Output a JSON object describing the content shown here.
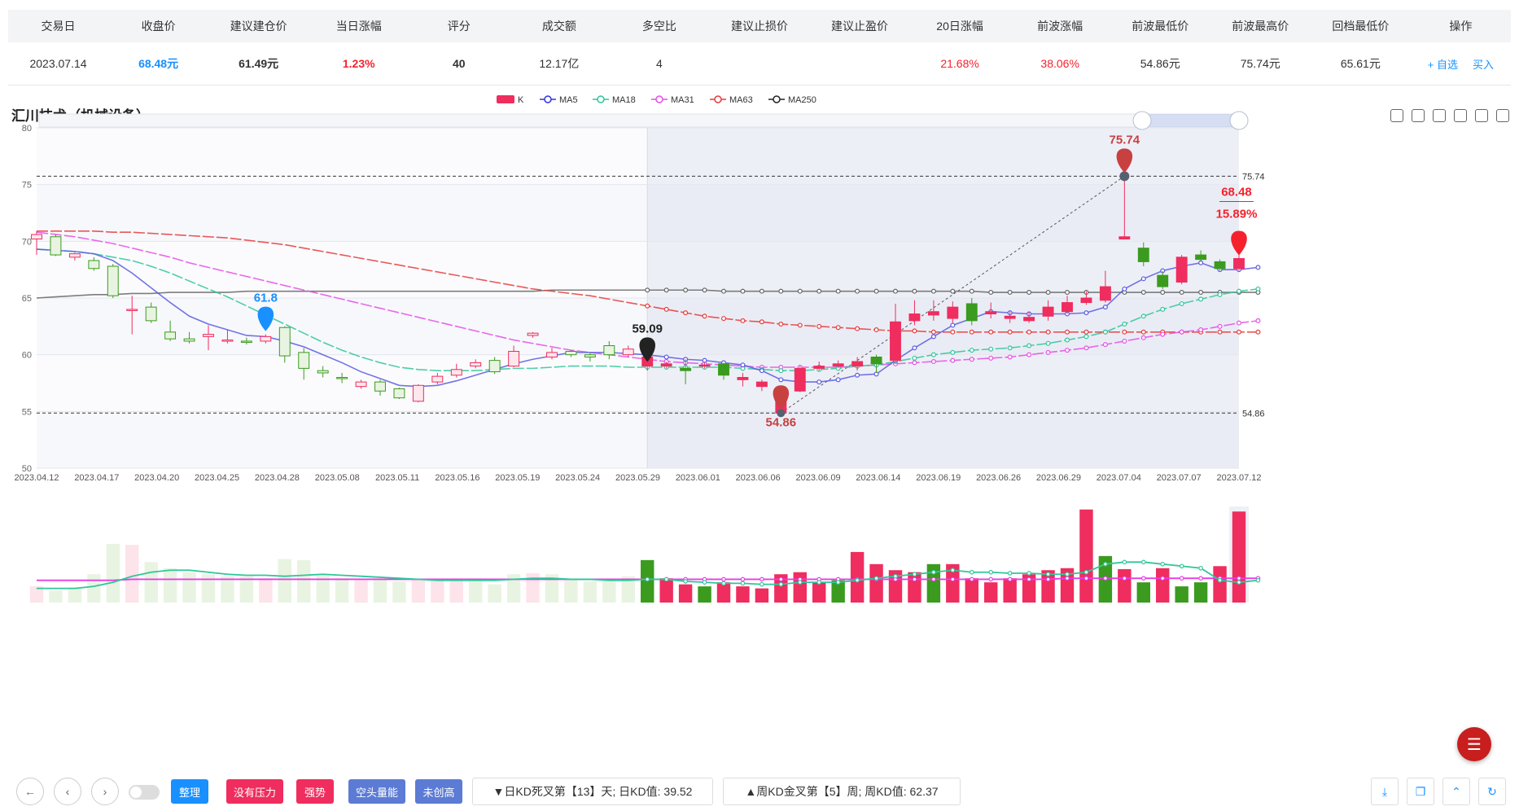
{
  "table": {
    "headers": [
      "交易日",
      "收盘价",
      "建议建仓价",
      "当日涨幅",
      "评分",
      "成交额",
      "多空比",
      "建议止损价",
      "建议止盈价",
      "20日涨幅",
      "前波涨幅",
      "前波最低价",
      "前波最高价",
      "回档最低价",
      "操作"
    ],
    "row": {
      "date": "2023.07.14",
      "close": "68.48元",
      "entry": "61.49元",
      "change": "1.23%",
      "score": "40",
      "turnover": "12.17亿",
      "ratio": "4",
      "stop_loss": "",
      "take_profit": "",
      "chg20": "21.68%",
      "wave_chg": "38.06%",
      "wave_low": "54.86元",
      "wave_high": "75.74元",
      "pullback_low": "65.61元"
    },
    "ops": {
      "watch": "+ 自选",
      "buy": "买入"
    }
  },
  "chart_title": "汇川技术（机械设备）",
  "legend": [
    "K",
    "MA5",
    "MA18",
    "MA31",
    "MA63",
    "MA250"
  ],
  "colors": {
    "up": "#ef2d5e",
    "down": "#3a9b1e",
    "ma5": "#3333dd",
    "ma18": "#2ec799",
    "ma31": "#e64ee6",
    "ma63": "#e63b3b",
    "ma250": "#222222"
  },
  "chart_data": {
    "type": "candlestick",
    "ylim": [
      50,
      80
    ],
    "yticks": [
      50,
      55,
      60,
      65,
      70,
      75,
      80
    ],
    "xtick_labels": [
      "2023.04.12",
      "2023.04.17",
      "2023.04.20",
      "2023.04.25",
      "2023.04.28",
      "2023.05.08",
      "2023.05.11",
      "2023.05.16",
      "2023.05.19",
      "2023.05.24",
      "2023.05.29",
      "2023.06.01",
      "2023.06.06",
      "2023.06.09",
      "2023.06.14",
      "2023.06.19",
      "2023.06.26",
      "2023.06.29",
      "2023.07.04",
      "2023.07.07",
      "2023.07.12"
    ],
    "candles": [
      [
        70.2,
        70.6,
        68.8,
        70.9
      ],
      [
        70.4,
        68.8,
        68.7,
        70.6
      ],
      [
        68.6,
        68.9,
        68.3,
        69.0
      ],
      [
        68.3,
        67.6,
        67.4,
        68.6
      ],
      [
        67.8,
        65.2,
        65.0,
        68.0
      ],
      [
        64.0,
        64.0,
        61.8,
        65.2
      ],
      [
        64.2,
        63.0,
        62.8,
        64.6
      ],
      [
        62.0,
        61.4,
        61.2,
        63.0
      ],
      [
        61.4,
        61.2,
        61.0,
        62.0
      ],
      [
        61.6,
        61.8,
        60.4,
        62.6
      ],
      [
        61.3,
        61.3,
        61.0,
        62.2
      ],
      [
        61.2,
        61.1,
        60.9,
        61.5
      ],
      [
        61.2,
        61.6,
        61.0,
        61.8
      ],
      [
        62.4,
        59.9,
        59.3,
        62.5
      ],
      [
        60.2,
        58.8,
        57.8,
        60.6
      ],
      [
        58.6,
        58.4,
        58.0,
        59.0
      ],
      [
        58.0,
        57.9,
        57.5,
        58.4
      ],
      [
        57.2,
        57.6,
        57.0,
        57.8
      ],
      [
        57.6,
        56.8,
        56.4,
        57.8
      ],
      [
        57.0,
        56.2,
        56.1,
        57.1
      ],
      [
        55.9,
        57.3,
        55.8,
        57.4
      ],
      [
        57.6,
        58.1,
        57.4,
        58.4
      ],
      [
        58.2,
        58.7,
        58.0,
        59.2
      ],
      [
        59.0,
        59.3,
        58.8,
        59.6
      ],
      [
        59.5,
        58.5,
        58.3,
        59.8
      ],
      [
        59.0,
        60.3,
        58.9,
        60.8
      ],
      [
        61.7,
        61.9,
        61.5,
        62.0
      ],
      [
        59.8,
        60.2,
        59.6,
        60.6
      ],
      [
        60.3,
        60.0,
        59.8,
        60.4
      ],
      [
        60.0,
        59.8,
        59.4,
        60.2
      ],
      [
        60.8,
        60.0,
        59.6,
        61.2
      ],
      [
        60.0,
        60.5,
        59.8,
        60.8
      ],
      [
        59.0,
        59.8,
        58.6,
        60.8
      ],
      [
        59.0,
        59.2,
        58.8,
        59.4
      ],
      [
        58.8,
        58.6,
        57.4,
        59.6
      ],
      [
        59.0,
        59.1,
        58.8,
        59.3
      ],
      [
        59.2,
        58.2,
        57.8,
        59.3
      ],
      [
        57.8,
        58.0,
        57.2,
        58.4
      ],
      [
        57.2,
        57.6,
        56.8,
        57.8
      ],
      [
        54.86,
        56.8,
        54.86,
        57.2
      ],
      [
        56.8,
        58.8,
        56.7,
        59.0
      ],
      [
        58.8,
        59.0,
        58.6,
        59.4
      ],
      [
        59.0,
        59.2,
        58.8,
        59.5
      ],
      [
        59.0,
        59.4,
        58.6,
        59.8
      ],
      [
        59.8,
        59.2,
        58.4,
        60.0
      ],
      [
        59.5,
        62.9,
        59.3,
        64.5
      ],
      [
        63.0,
        63.6,
        62.6,
        64.8
      ],
      [
        63.5,
        63.8,
        63.0,
        64.8
      ],
      [
        63.2,
        64.2,
        62.8,
        64.7
      ],
      [
        64.5,
        63.0,
        62.6,
        65.0
      ],
      [
        63.6,
        63.8,
        63.2,
        64.6
      ],
      [
        63.2,
        63.4,
        62.8,
        63.8
      ],
      [
        63.0,
        63.3,
        62.8,
        63.8
      ],
      [
        63.4,
        64.2,
        63.0,
        64.8
      ],
      [
        63.8,
        64.6,
        63.6,
        65.2
      ],
      [
        64.6,
        65.0,
        64.4,
        65.6
      ],
      [
        64.8,
        66.0,
        64.6,
        67.4
      ],
      [
        70.2,
        70.4,
        70.2,
        75.74
      ],
      [
        69.4,
        68.2,
        67.8,
        69.9
      ],
      [
        67.0,
        66.0,
        65.8,
        67.4
      ],
      [
        66.4,
        68.6,
        66.2,
        68.8
      ],
      [
        68.8,
        68.4,
        68.2,
        69.2
      ],
      [
        68.2,
        67.6,
        67.4,
        68.4
      ],
      [
        67.6,
        68.48,
        67.4,
        69.0
      ]
    ],
    "volumes": [
      [
        16,
        1
      ],
      [
        12,
        0
      ],
      [
        15,
        0
      ],
      [
        28,
        0
      ],
      [
        58,
        0
      ],
      [
        57,
        1
      ],
      [
        40,
        0
      ],
      [
        34,
        0
      ],
      [
        30,
        0
      ],
      [
        28,
        0
      ],
      [
        26,
        0
      ],
      [
        26,
        0
      ],
      [
        24,
        1
      ],
      [
        43,
        0
      ],
      [
        42,
        0
      ],
      [
        28,
        0
      ],
      [
        24,
        0
      ],
      [
        22,
        1
      ],
      [
        23,
        0
      ],
      [
        21,
        0
      ],
      [
        22,
        1
      ],
      [
        23,
        1
      ],
      [
        24,
        1
      ],
      [
        24,
        0
      ],
      [
        18,
        0
      ],
      [
        28,
        0
      ],
      [
        29,
        1
      ],
      [
        28,
        0
      ],
      [
        22,
        0
      ],
      [
        21,
        0
      ],
      [
        22,
        0
      ],
      [
        26,
        0
      ],
      [
        42,
        0
      ],
      [
        24,
        1
      ],
      [
        18,
        1
      ],
      [
        16,
        0
      ],
      [
        20,
        1
      ],
      [
        16,
        1
      ],
      [
        14,
        1
      ],
      [
        28,
        1
      ],
      [
        30,
        1
      ],
      [
        20,
        1
      ],
      [
        22,
        0
      ],
      [
        50,
        1
      ],
      [
        38,
        1
      ],
      [
        32,
        1
      ],
      [
        30,
        1
      ],
      [
        38,
        0
      ],
      [
        38,
        1
      ],
      [
        24,
        1
      ],
      [
        20,
        1
      ],
      [
        24,
        1
      ],
      [
        28,
        1
      ],
      [
        32,
        1
      ],
      [
        34,
        1
      ],
      [
        92,
        1
      ],
      [
        46,
        0
      ],
      [
        33,
        1
      ],
      [
        20,
        0
      ],
      [
        34,
        1
      ],
      [
        16,
        0
      ],
      [
        20,
        0
      ],
      [
        36,
        1
      ],
      [
        90,
        1
      ]
    ],
    "volume_scale": 95,
    "ma5": [
      69.3,
      69.2,
      69.1,
      68.9,
      68.3,
      67.2,
      65.9,
      64.6,
      63.4,
      62.7,
      62.2,
      61.7,
      61.6,
      61.2,
      60.7,
      60.0,
      59.3,
      58.5,
      57.9,
      57.3,
      57.2,
      57.3,
      57.7,
      58.2,
      58.7,
      59.2,
      59.6,
      59.9,
      60.2,
      60.2,
      60.2,
      60.1,
      60.0,
      59.8,
      59.6,
      59.5,
      59.3,
      59.1,
      58.6,
      57.8,
      57.6,
      57.6,
      57.8,
      58.2,
      58.3,
      59.5,
      60.6,
      61.6,
      62.6,
      63.2,
      63.8,
      63.7,
      63.6,
      63.6,
      63.6,
      63.7,
      64.2,
      65.8,
      66.7,
      67.4,
      67.8,
      68.1,
      67.5,
      67.5,
      67.7
    ],
    "ma18": [
      69.3,
      69.2,
      69.1,
      68.9,
      68.6,
      68.3,
      67.8,
      67.2,
      66.5,
      65.8,
      65.1,
      64.3,
      63.5,
      62.7,
      61.9,
      61.1,
      60.4,
      59.8,
      59.3,
      58.9,
      58.7,
      58.6,
      58.6,
      58.6,
      58.7,
      58.8,
      58.8,
      58.9,
      59.0,
      59.0,
      59.0,
      58.9,
      58.9,
      58.9,
      58.9,
      58.9,
      58.9,
      58.8,
      58.7,
      58.6,
      58.6,
      58.7,
      58.8,
      59.0,
      59.1,
      59.4,
      59.7,
      60.0,
      60.2,
      60.4,
      60.5,
      60.6,
      60.8,
      61.0,
      61.3,
      61.6,
      62.0,
      62.7,
      63.4,
      64.0,
      64.5,
      64.9,
      65.3,
      65.6,
      65.8
    ],
    "ma31": [
      70.8,
      70.6,
      70.4,
      70.1,
      69.8,
      69.4,
      69.0,
      68.6,
      68.1,
      67.7,
      67.3,
      66.9,
      66.5,
      66.1,
      65.7,
      65.3,
      64.9,
      64.5,
      64.1,
      63.7,
      63.3,
      62.9,
      62.5,
      62.1,
      61.7,
      61.3,
      61.0,
      60.7,
      60.4,
      60.2,
      60.0,
      59.8,
      59.6,
      59.4,
      59.3,
      59.2,
      59.1,
      59.0,
      58.9,
      58.9,
      58.9,
      58.9,
      58.9,
      59.0,
      59.1,
      59.2,
      59.3,
      59.4,
      59.5,
      59.6,
      59.7,
      59.8,
      60.0,
      60.2,
      60.4,
      60.6,
      60.9,
      61.2,
      61.5,
      61.8,
      62.0,
      62.2,
      62.5,
      62.8,
      63.0
    ],
    "ma63": [
      70.9,
      70.9,
      70.9,
      70.9,
      70.8,
      70.8,
      70.7,
      70.6,
      70.5,
      70.4,
      70.3,
      70.1,
      69.9,
      69.7,
      69.4,
      69.1,
      68.8,
      68.5,
      68.2,
      67.9,
      67.6,
      67.3,
      67.0,
      66.7,
      66.4,
      66.1,
      65.8,
      65.6,
      65.4,
      65.2,
      64.9,
      64.6,
      64.3,
      64.0,
      63.7,
      63.4,
      63.2,
      63.0,
      62.9,
      62.7,
      62.6,
      62.5,
      62.4,
      62.3,
      62.2,
      62.1,
      62.1,
      62.0,
      62.0,
      62.0,
      62.0,
      62.0,
      62.0,
      62.0,
      62.0,
      62.0,
      62.0,
      62.0,
      62.0,
      62.0,
      62.0,
      62.0,
      62.0,
      62.0,
      62.0
    ],
    "ma250": [
      65.0,
      65.1,
      65.2,
      65.3,
      65.3,
      65.4,
      65.4,
      65.5,
      65.5,
      65.5,
      65.5,
      65.6,
      65.6,
      65.6,
      65.6,
      65.6,
      65.6,
      65.6,
      65.6,
      65.6,
      65.6,
      65.6,
      65.6,
      65.6,
      65.6,
      65.6,
      65.6,
      65.7,
      65.7,
      65.7,
      65.7,
      65.7,
      65.7,
      65.7,
      65.7,
      65.7,
      65.6,
      65.6,
      65.6,
      65.6,
      65.6,
      65.6,
      65.6,
      65.6,
      65.6,
      65.6,
      65.6,
      65.6,
      65.6,
      65.6,
      65.5,
      65.5,
      65.5,
      65.5,
      65.5,
      65.5,
      65.5,
      65.5,
      65.5,
      65.5,
      65.5,
      65.5,
      65.5,
      65.5,
      65.5
    ],
    "vol_ma_a": [
      14,
      14,
      14,
      16,
      20,
      26,
      30,
      32,
      32,
      30,
      28,
      27,
      27,
      26,
      27,
      28,
      27,
      26,
      25,
      24,
      23,
      22,
      22,
      22,
      22,
      23,
      24,
      24,
      23,
      23,
      22,
      22,
      23,
      23,
      21,
      20,
      19,
      19,
      18,
      18,
      20,
      20,
      20,
      22,
      24,
      26,
      28,
      30,
      32,
      30,
      30,
      29,
      29,
      28,
      28,
      30,
      38,
      40,
      40,
      38,
      36,
      34,
      22,
      20,
      22
    ],
    "vol_ma_b": [
      22,
      22,
      22,
      22,
      22,
      23,
      23,
      23,
      23,
      23,
      23,
      23,
      23,
      23,
      23,
      23,
      23,
      23,
      23,
      23,
      23,
      23,
      23,
      23,
      23,
      23,
      23,
      23,
      23,
      23,
      23,
      23,
      23,
      23,
      23,
      23,
      23,
      23,
      23,
      23,
      23,
      23,
      23,
      23,
      23,
      23,
      23,
      23,
      23,
      23,
      23,
      23,
      23,
      23,
      24,
      24,
      24,
      24,
      24,
      24,
      24,
      24,
      24,
      24,
      24
    ],
    "annotations": [
      {
        "label": "61.8",
        "index": 12,
        "value": 61.8,
        "color": "#1890ff"
      },
      {
        "label": "59.09",
        "index": 32,
        "value": 59.09,
        "color": "#222222"
      },
      {
        "label": "54.86",
        "index": 39,
        "value": 54.86,
        "color": "#c94040"
      },
      {
        "label": "75.74",
        "index": 57,
        "value": 75.74,
        "color": "#c94040"
      }
    ],
    "last_price_label": "68.48",
    "last_change_label": "15.89%",
    "level_lines": [
      {
        "value": 75.74,
        "label": "75.74"
      },
      {
        "value": 54.86,
        "label": "54.86"
      }
    ],
    "highlight_start_index": 32
  },
  "bottom": {
    "tags": [
      {
        "label": "整理",
        "color": "#1890ff"
      },
      {
        "label": "没有压力",
        "color": "#ef2d5e"
      },
      {
        "label": "强势",
        "color": "#ef2d5e"
      },
      {
        "label": "空头量能",
        "color": "#5b7bd5"
      },
      {
        "label": "未创高",
        "color": "#5b7bd5"
      }
    ],
    "info1": "▼日KD死叉第【13】天; 日KD值: 39.52",
    "info2": "▲周KD金叉第【5】周; 周KD值: 62.37"
  }
}
